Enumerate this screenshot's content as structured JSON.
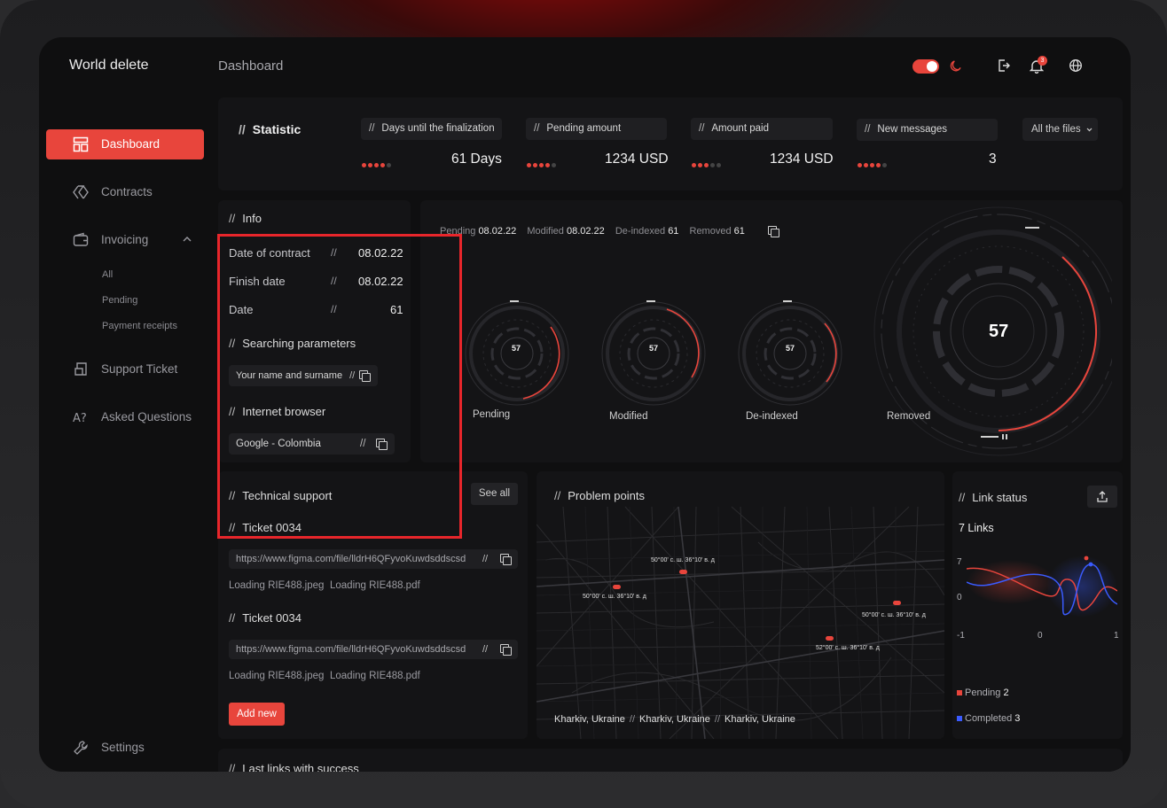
{
  "app": {
    "brand": "World delete",
    "page_title": "Dashboard"
  },
  "topbar": {
    "notification_count": "3"
  },
  "sidebar": {
    "items": [
      {
        "label": "Dashboard",
        "icon": "dashboard-icon",
        "active": true
      },
      {
        "label": "Contracts",
        "icon": "contracts-icon"
      },
      {
        "label": "Invoicing",
        "icon": "wallet-icon"
      },
      {
        "label": "Support Ticket",
        "icon": "ticket-icon"
      },
      {
        "label": "Asked Questions",
        "icon": "question-icon"
      }
    ],
    "invoicing_sub": [
      "All",
      "Pending",
      "Payment receipts"
    ],
    "settings_label": "Settings"
  },
  "statistic": {
    "title": "Statistic",
    "filter": "All the files",
    "cards": [
      {
        "label": "Days until the finalization",
        "value": "61 Days",
        "level": 4
      },
      {
        "label": "Pending amount",
        "value": "1234 USD",
        "level": 4
      },
      {
        "label": "Amount paid",
        "value": "1234 USD",
        "level": 3
      },
      {
        "label": "New messages",
        "value": "3",
        "level": 4
      }
    ]
  },
  "info": {
    "title": "Info",
    "rows": [
      {
        "label": "Date of contract",
        "value": "08.02.22"
      },
      {
        "label": "Finish date",
        "value": "08.02.22"
      },
      {
        "label": "Date",
        "value": "61"
      }
    ],
    "search_title": "Searching parameters",
    "search_value": "Your name and surname",
    "browser_title": "Internet browser",
    "browser_value": "Google - Colombia"
  },
  "rings": {
    "summary": [
      {
        "label": "Pending",
        "value": "08.02.22"
      },
      {
        "label": "Modified",
        "value": "08.02.22"
      },
      {
        "label": "De-indexed",
        "value": "61"
      },
      {
        "label": "Removed",
        "value": "61"
      }
    ],
    "gauges": [
      {
        "label": "Pending",
        "value": "57"
      },
      {
        "label": "Modified",
        "value": "57"
      },
      {
        "label": "De-indexed",
        "value": "57"
      },
      {
        "label": "Removed",
        "value": "57"
      }
    ]
  },
  "support": {
    "title": "Technical support",
    "see_all": "See all",
    "tickets": [
      {
        "title": "Ticket 0034",
        "url": "https://www.figma.com/file/lldrH6QFyvoKuwdsddscsd",
        "files": [
          "Loading RIE488.jpeg",
          "Loading RIE488.pdf"
        ]
      },
      {
        "title": "Ticket 0034",
        "url": "https://www.figma.com/file/lldrH6QFyvoKuwdsddscsd",
        "files": [
          "Loading RIE488.jpeg",
          "Loading RIE488.pdf"
        ]
      }
    ],
    "add_new": "Add new"
  },
  "map": {
    "title": "Problem points",
    "markers": [
      "50°00' с. ш. 36°10' в. д",
      "50°00' с. ш. 36°10' в. д",
      "50°00' с. ш. 36°10' в. д",
      "52°00' с. ш. 36°10' в. д"
    ],
    "cities": [
      "Kharkiv, Ukraine",
      "Kharkiv, Ukraine",
      "Kharkiv, Ukraine"
    ]
  },
  "link_status": {
    "title": "Link status",
    "count": "7 Links",
    "y_ticks": [
      "7",
      "0"
    ],
    "x_ticks": [
      "-1",
      "0",
      "1"
    ],
    "legend": [
      {
        "label": "Pending",
        "value": "2",
        "color": "#e8453c"
      },
      {
        "label": "Completed",
        "value": "3",
        "color": "#3a5bff"
      }
    ]
  },
  "last_links": {
    "title": "Last links with success"
  }
}
